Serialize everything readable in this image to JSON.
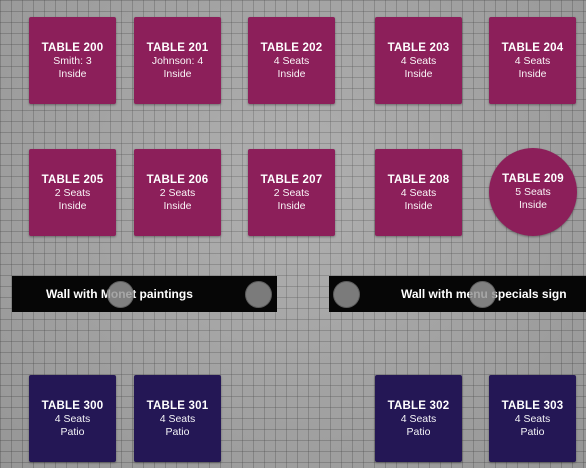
{
  "colors": {
    "inside_table": "#8c1f5a",
    "patio_table": "#241755",
    "wall": "#060606",
    "floor": "#a7a7a7"
  },
  "tables": {
    "t200": {
      "name": "TABLE 200",
      "line1": "Smith: 3",
      "line2": "Inside"
    },
    "t201": {
      "name": "TABLE 201",
      "line1": "Johnson: 4",
      "line2": "Inside"
    },
    "t202": {
      "name": "TABLE 202",
      "line1": "4 Seats",
      "line2": "Inside"
    },
    "t203": {
      "name": "TABLE 203",
      "line1": "4 Seats",
      "line2": "Inside"
    },
    "t204": {
      "name": "TABLE 204",
      "line1": "4 Seats",
      "line2": "Inside"
    },
    "t205": {
      "name": "TABLE 205",
      "line1": "2 Seats",
      "line2": "Inside"
    },
    "t206": {
      "name": "TABLE 206",
      "line1": "2 Seats",
      "line2": "Inside"
    },
    "t207": {
      "name": "TABLE 207",
      "line1": "2 Seats",
      "line2": "Inside"
    },
    "t208": {
      "name": "TABLE 208",
      "line1": "4 Seats",
      "line2": "Inside"
    },
    "t209": {
      "name": "TABLE 209",
      "line1": "5 Seats",
      "line2": "Inside"
    },
    "t300": {
      "name": "TABLE 300",
      "line1": "4 Seats",
      "line2": "Patio"
    },
    "t301": {
      "name": "TABLE 301",
      "line1": "4 Seats",
      "line2": "Patio"
    },
    "t302": {
      "name": "TABLE 302",
      "line1": "4 Seats",
      "line2": "Patio"
    },
    "t303": {
      "name": "TABLE 303",
      "line1": "4 Seats",
      "line2": "Patio"
    }
  },
  "walls": {
    "left": {
      "label": "Wall with Monet paintings"
    },
    "right": {
      "label": "Wall with menu specials sign"
    }
  }
}
